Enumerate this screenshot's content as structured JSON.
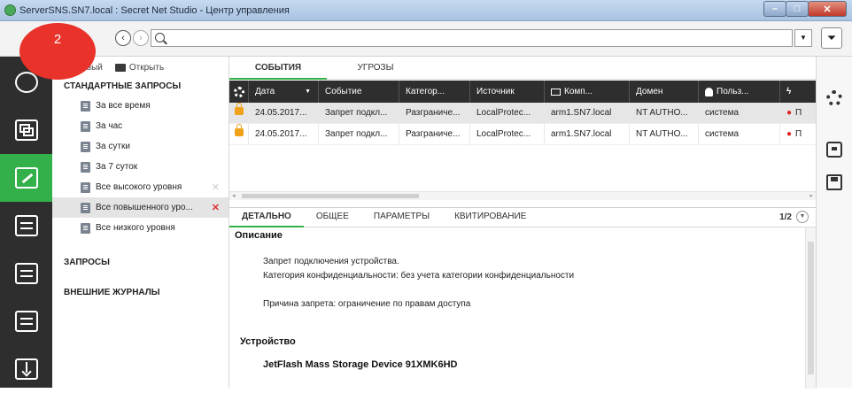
{
  "window": {
    "title": "ServerSNS.SN7.local : Secret Net Studio - Центр управления"
  },
  "badge": {
    "number": "2",
    "color": "#e8322a"
  },
  "toolbar": {
    "search_value": "",
    "back_icon": "arrow-left-circle",
    "forward_icon": "arrow-right-circle",
    "filter_icon": "funnel"
  },
  "tree": {
    "new_label": "Новый",
    "open_label": "Открыть",
    "section_standard": "СТАНДАРТНЫЕ ЗАПРОСЫ",
    "items": [
      {
        "label": "За все время"
      },
      {
        "label": "За час"
      },
      {
        "label": "За сутки"
      },
      {
        "label": "За 7 суток"
      },
      {
        "label": "Все высокого уровня"
      },
      {
        "label": "Все повышенного уро..."
      },
      {
        "label": "Все низкого уровня"
      }
    ],
    "section_queries": "ЗАПРОСЫ",
    "section_external": "ВНЕШНИЕ ЖУРНАЛЫ"
  },
  "top_tabs": [
    "СОБЫТИЯ",
    "УГРОЗЫ"
  ],
  "grid": {
    "columns": [
      "Дата",
      "Событие",
      "Категор...",
      "Источник",
      "Комп...",
      "Домен",
      "Польз..."
    ],
    "rows": [
      {
        "date": "24.05.2017...",
        "event": "Запрет подкл...",
        "category": "Разграниче...",
        "source": "LocalProtec...",
        "computer": "arm1.SN7.local",
        "domain": "NT AUTHO...",
        "user": "система",
        "status": "П"
      },
      {
        "date": "24.05.2017...",
        "event": "Запрет подкл...",
        "category": "Разграниче...",
        "source": "LocalProtec...",
        "computer": "arm1.SN7.local",
        "domain": "NT AUTHO...",
        "user": "система",
        "status": "П"
      }
    ]
  },
  "detail": {
    "tabs": [
      "ДЕТАЛЬНО",
      "ОБЩЕЕ",
      "ПАРАМЕТРЫ",
      "КВИТИРОВАНИЕ"
    ],
    "pager": "1/2",
    "description_heading": "Описание",
    "line1": "Запрет подключения устройства.",
    "line2": "Категория конфиденциальности: без учета категории конфиденциальности",
    "line3": "Причина запрета: ограничение по правам доступа",
    "device_heading": "Устройство",
    "device_name": "JetFlash Mass Storage Device 91XMK6HD"
  },
  "accent_color": "#34b04a",
  "sidebar_icons": [
    "monitoring-icon",
    "network-structure-icon",
    "journal-icon",
    "policies-icon",
    "licenses-icon",
    "deployment-icon",
    "download-icon"
  ]
}
